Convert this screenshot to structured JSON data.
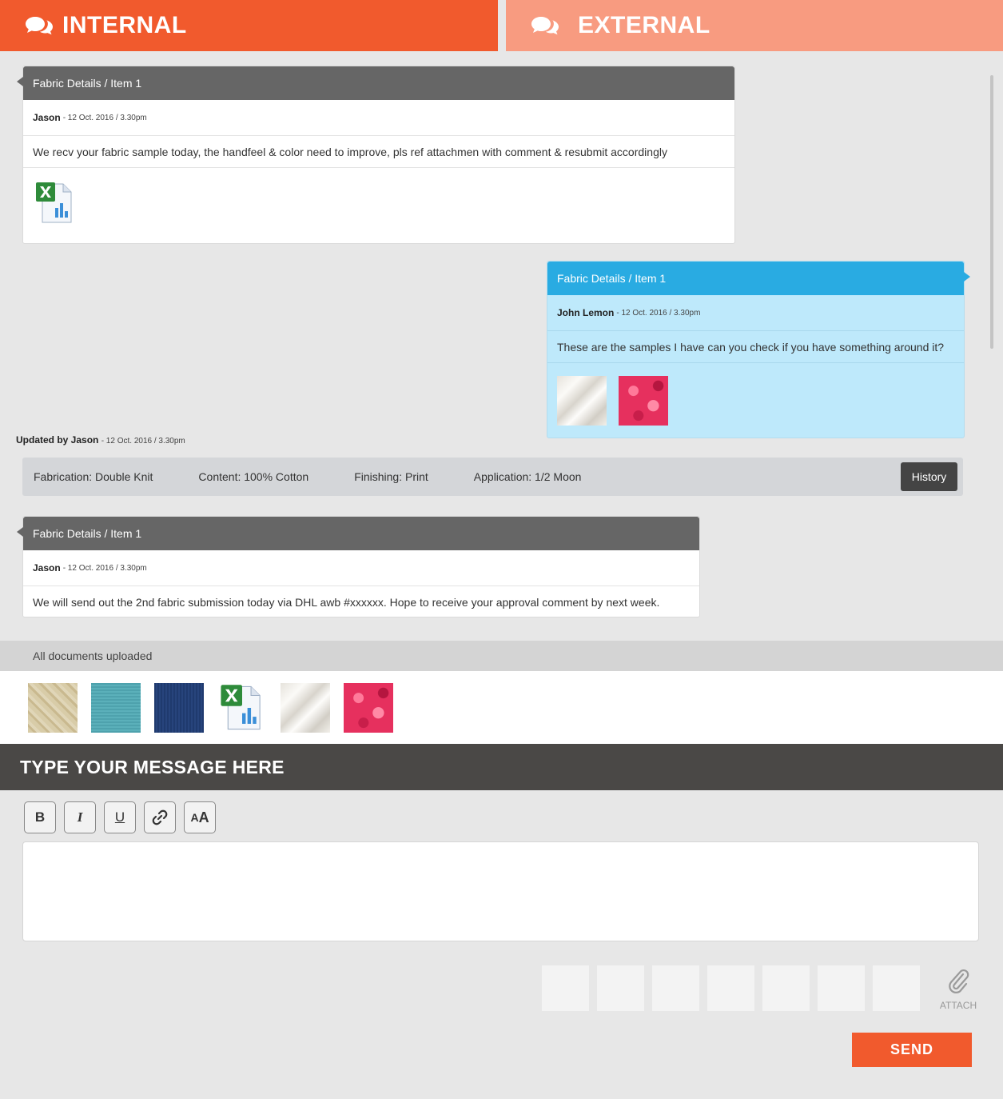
{
  "tabs": {
    "internal": "INTERNAL",
    "external": "EXTERNAL"
  },
  "messages": [
    {
      "title": "Fabric Details / Item 1",
      "author": "Jason",
      "time": "- 12 Oct. 2016 / 3.30pm",
      "text": "We recv your fabric sample today, the handfeel & color need to improve, pls ref attachmen with comment & resubmit  accordingly",
      "attachments": [
        "excel-file-icon"
      ]
    },
    {
      "title": "Fabric Details / Item 1",
      "author": "John Lemon",
      "time": "- 12 Oct. 2016 / 3.30pm",
      "text": "These are the samples I have can you check if you have something around it?",
      "attachments": [
        "white-silk-fabric",
        "pink-ruffle-fabric"
      ]
    },
    {
      "title": "Fabric Details / Item 1",
      "author": "Jason",
      "time": "- 12 Oct. 2016 / 3.30pm",
      "text": "We will send out the 2nd fabric submission today via DHL awb #xxxxxx. Hope to receive your approval comment by next week."
    }
  ],
  "update": {
    "label": "Updated by Jason",
    "time": "- 12 Oct. 2016 / 3.30pm"
  },
  "properties": {
    "fabrication": "Fabrication: Double Knit",
    "content": "Content: 100% Cotton",
    "finishing": "Finishing: Print",
    "application": "Application: 1/2 Moon",
    "history_label": "History"
  },
  "documents": {
    "heading": "All documents uploaded",
    "items": [
      "beige-leaf-fabric",
      "teal-fabric",
      "navy-fabric",
      "excel-file-icon",
      "white-silk-fabric",
      "pink-ruffle-fabric"
    ]
  },
  "composer": {
    "heading": "TYPE YOUR MESSAGE HERE",
    "tools": {
      "bold": "B",
      "italic": "I",
      "underline": "U",
      "font_size_small": "A",
      "font_size_big": "A"
    },
    "attach_label": "ATTACH",
    "send_label": "SEND"
  },
  "colors": {
    "accent": "#f15a2d",
    "external_tab": "#f89b80",
    "internal_card_header": "#666666",
    "external_card_header": "#29abe2",
    "external_card_body": "#bee9fb"
  }
}
